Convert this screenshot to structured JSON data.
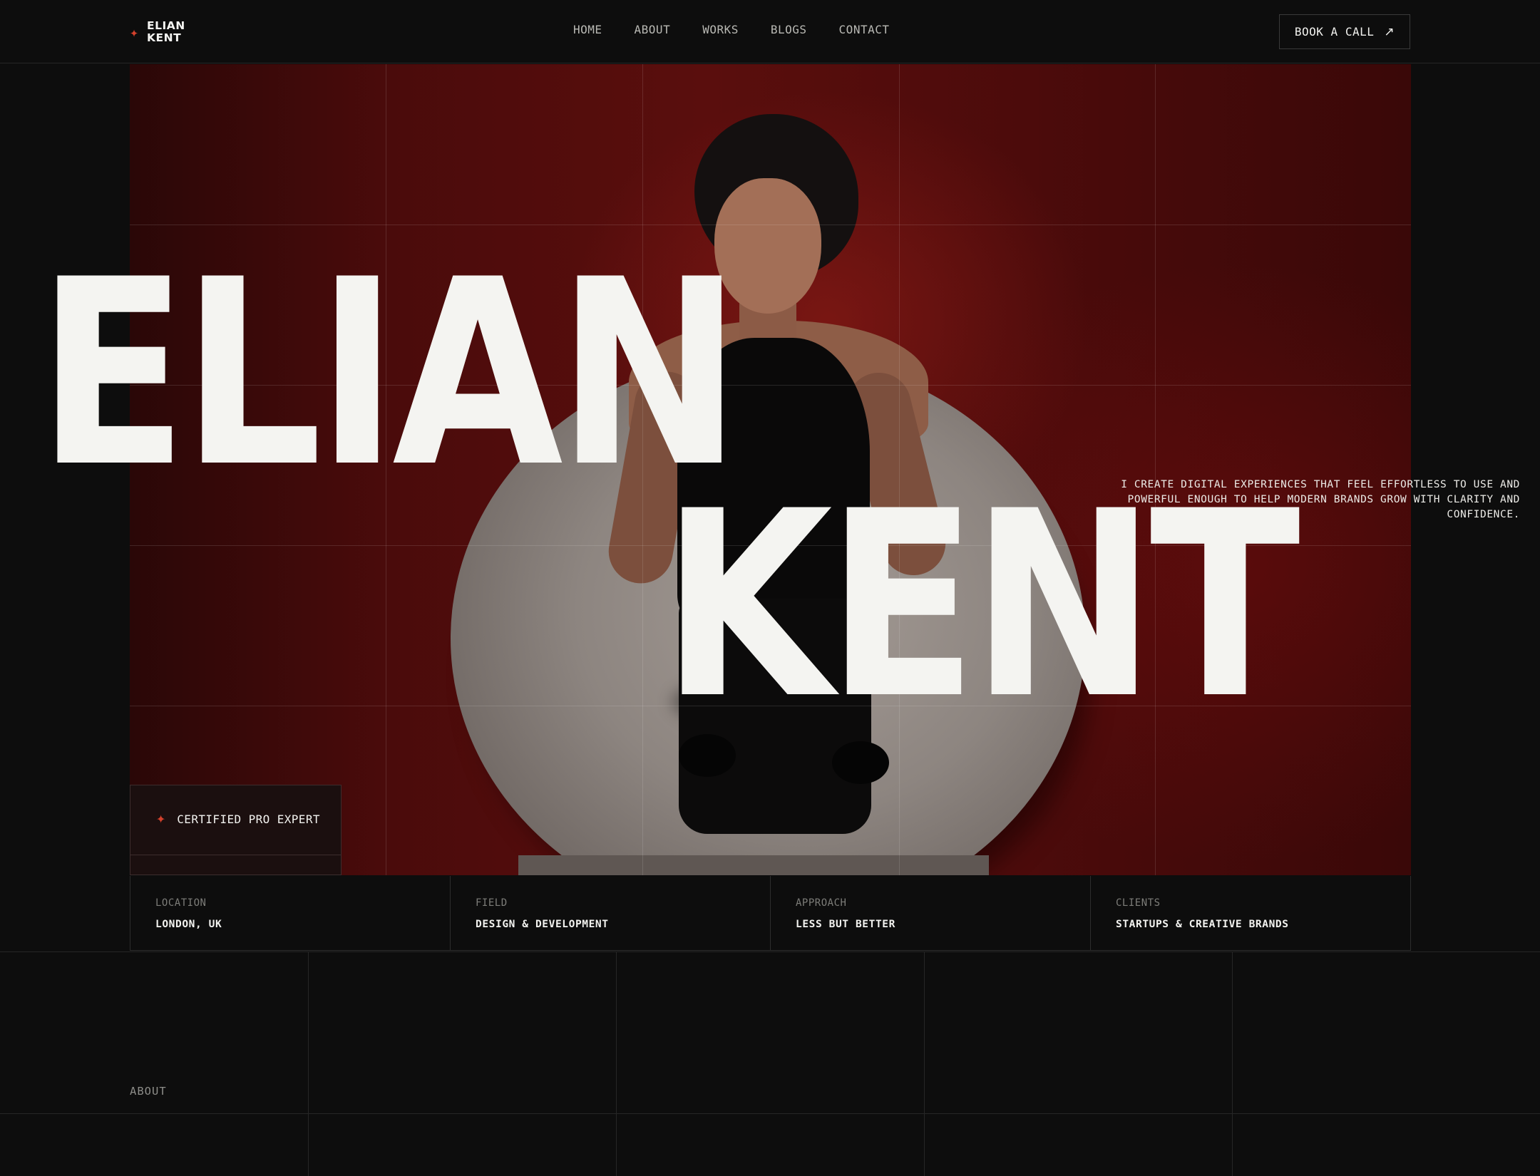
{
  "brand": {
    "line1": "ELIAN",
    "line2": "KENT",
    "star_icon": "four-point-star",
    "accent_color": "#d4412c"
  },
  "nav": {
    "items": [
      "HOME",
      "ABOUT",
      "WORKS",
      "BLOGS",
      "CONTACT"
    ]
  },
  "cta": {
    "label": "BOOK A CALL",
    "arrow": "↗"
  },
  "hero": {
    "name_line1": "ELIAN",
    "name_line2": "KENT",
    "tagline": "I CREATE DIGITAL EXPERIENCES THAT FEEL EFFORTLESS TO USE AND POWERFUL ENOUGH TO HELP MODERN BRANDS GROW WITH CLARITY AND CONFIDENCE.",
    "badge": "CERTIFIED PRO EXPERT",
    "background_color": "#5a0e0d"
  },
  "info": [
    {
      "label": "LOCATION",
      "value": "LONDON, UK"
    },
    {
      "label": "FIELD",
      "value": "DESIGN & DEVELOPMENT"
    },
    {
      "label": "APPROACH",
      "value": "LESS BUT BETTER"
    },
    {
      "label": "CLIENTS",
      "value": "STARTUPS & CREATIVE BRANDS"
    }
  ],
  "about": {
    "label": "ABOUT"
  }
}
